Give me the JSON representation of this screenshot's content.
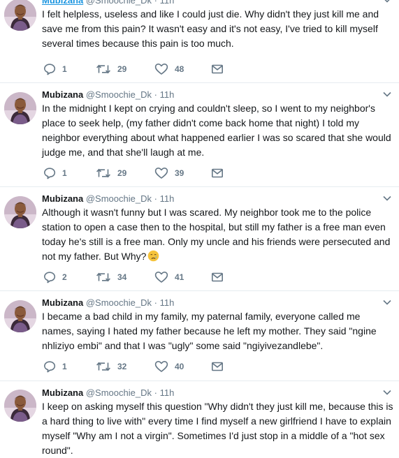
{
  "tweets": [
    {
      "name": "Mubizana",
      "handle": "@Smoochie_Dk",
      "time": "11h",
      "text": "I felt helpless, useless and like I could just die. Why didn't they just kill me and save me from this pain? It wasn't easy and it's not easy, I've tried to kill myself several times because this pain is too much.",
      "replies": "1",
      "retweets": "29",
      "likes": "48"
    },
    {
      "name": "Mubizana",
      "handle": "@Smoochie_Dk",
      "time": "11h",
      "text": "In the midnight I kept on crying and couldn't sleep, so I went to my neighbor's place to seek help, (my father didn't come back home that night) I told my neighbor everything about what happened earlier I was so scared that she would judge me, and that she'll laugh at me.",
      "replies": "1",
      "retweets": "29",
      "likes": "39"
    },
    {
      "name": "Mubizana",
      "handle": "@Smoochie_Dk",
      "time": "11h",
      "text": "Although it wasn't funny but I was scared. My neighbor took me to the police station to open a case then to the hospital, but still my father is a free man even today he's still is a free man. Only my uncle and his friends were persecuted and not my father. But Why?",
      "emoji": "crying-face-emoji",
      "replies": "2",
      "retweets": "34",
      "likes": "41"
    },
    {
      "name": "Mubizana",
      "handle": "@Smoochie_Dk",
      "time": "11h",
      "text": "I became a bad child in my family, my paternal family, everyone called me names, saying I hated my father because he left my mother. They said \"ngine nhliziyo embi\" and that I was \"ugly\" some said \"ngiyivezandlebe\".",
      "replies": "1",
      "retweets": "32",
      "likes": "40"
    },
    {
      "name": "Mubizana",
      "handle": "@Smoochie_Dk",
      "time": "11h",
      "text": "I keep on asking myself this question \"Why didn't they just kill me, because this is a hard thing to live with\" every time I find myself a new girlfriend I have to explain myself \"Why am I not a virgin\". Sometimes I'd just stop in a middle of a \"hot sex round\"."
    }
  ],
  "icons": {
    "reply": "reply-icon",
    "retweet": "retweet-icon",
    "like": "heart-icon",
    "dm": "envelope-icon",
    "menu": "chevron-down-icon"
  },
  "colors": {
    "link": "#1b95e0",
    "muted": "#657786",
    "text": "#14171a",
    "separator": "#e6ecf0"
  }
}
